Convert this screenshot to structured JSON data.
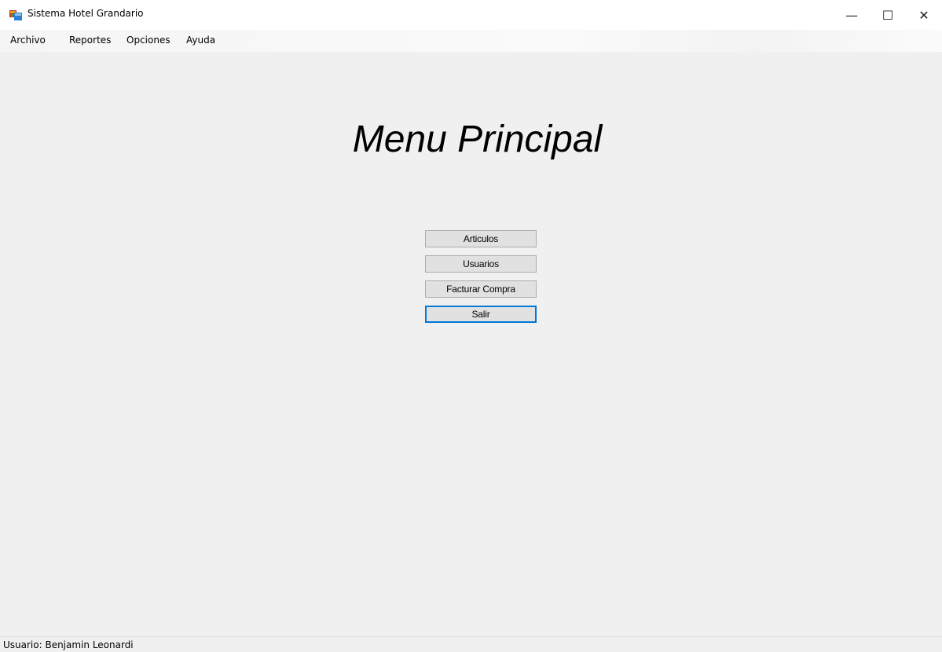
{
  "window": {
    "title": "Sistema Hotel Grandario",
    "controls": {
      "minimize": "—",
      "maximize": "☐",
      "close": "✕"
    }
  },
  "menubar": {
    "items": [
      {
        "label": "Archivo"
      },
      {
        "label": "Reportes"
      },
      {
        "label": "Opciones"
      },
      {
        "label": "Ayuda"
      }
    ]
  },
  "main": {
    "title": "Menu Principal",
    "buttons": [
      {
        "label": "Articulos"
      },
      {
        "label": "Usuarios"
      },
      {
        "label": "Facturar Compra"
      },
      {
        "label": "Salir",
        "focused": true
      }
    ]
  },
  "statusbar": {
    "user_text": "Usuario: Benjamin Leonardi"
  },
  "colors": {
    "background": "#f0f0f0",
    "button_face": "#e1e1e1",
    "button_border": "#adadad",
    "focus_border": "#0078d7"
  },
  "icons": {
    "app": "app-window-icon",
    "minimize": "minimize-icon",
    "maximize": "maximize-icon",
    "close": "close-icon"
  }
}
